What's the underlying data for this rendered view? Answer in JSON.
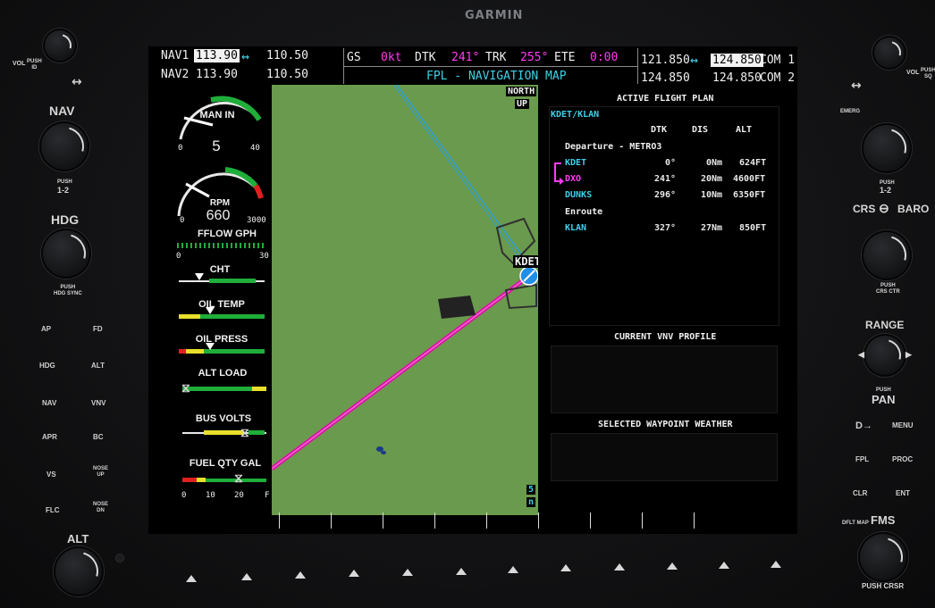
{
  "brand": "GARMIN",
  "left_panel": {
    "vol_label": "VOL",
    "vol_push": "PUSH\nID",
    "nav_label": "NAV",
    "nav_push": "PUSH",
    "nav_push2": "1-2",
    "hdg_label": "HDG",
    "hdg_push": "PUSH\nHDG SYNC",
    "buttons": [
      {
        "label": "AP"
      },
      {
        "label": "FD"
      },
      {
        "label": "HDG"
      },
      {
        "label": "ALT"
      },
      {
        "label": "NAV"
      },
      {
        "label": "VNV"
      },
      {
        "label": "APR"
      },
      {
        "label": "BC"
      },
      {
        "label": "VS"
      },
      {
        "label": "NOSE\nUP"
      },
      {
        "label": "FLC"
      },
      {
        "label": "NOSE\nDN"
      }
    ],
    "alt_label": "ALT"
  },
  "right_panel": {
    "vol_label": "VOL",
    "vol_push": "PUSH\nSQ",
    "emerg": "EMERG",
    "com_push": "PUSH",
    "com_push2": "1-2",
    "crs_baro": "CRS",
    "baro": "BARO",
    "crs_push": "PUSH\nCRS CTR",
    "range": "RANGE",
    "pan_push": "PUSH",
    "pan": "PAN",
    "buttons": [
      {
        "label": "MENU"
      },
      {
        "label": "FPL"
      },
      {
        "label": "PROC"
      },
      {
        "label": "CLR"
      },
      {
        "label": "ENT"
      }
    ],
    "direct_to": "D→",
    "dflt_map": "DFLT MAP",
    "fms": "FMS",
    "push_crsr": "PUSH CRSR"
  },
  "top_bar": {
    "nav1_label": "NAV1",
    "nav1_active": "113.90",
    "nav1_standby": "110.50",
    "nav2_label": "NAV2",
    "nav2_active": "113.90",
    "nav2_standby": "110.50",
    "gs_label": "GS",
    "gs_value": "0kt",
    "dtk_label": "DTK",
    "dtk_value": "241°",
    "trk_label": "TRK",
    "trk_value": "255°",
    "ete_label": "ETE",
    "ete_value": "0:00",
    "page_title": "FPL - NAVIGATION MAP",
    "com1_standby": "121.850",
    "com1_active": "124.850",
    "com1_label": "COM 1",
    "com2_standby": "124.850",
    "com2_active": "124.850",
    "com2_label": "COM 2"
  },
  "eis": {
    "manin_label": "MAN IN",
    "manin_value": "5",
    "manin_min": "0",
    "manin_max": "40",
    "rpm_label": "RPM",
    "rpm_value": "660",
    "rpm_min": "0",
    "rpm_max": "3000",
    "fflow_label": "FFLOW GPH",
    "fflow_min": "0",
    "fflow_max": "30",
    "cht_label": "CHT",
    "oiltemp_label": "OIL TEMP",
    "oilpress_label": "OIL PRESS",
    "altload_label": "ALT LOAD",
    "busvolts_label": "BUS VOLTS",
    "fuel_label": "FUEL QTY GAL",
    "fuel_ticks": [
      "0",
      "10",
      "20",
      "F"
    ]
  },
  "map": {
    "orientation_1": "NORTH",
    "orientation_2": "UP",
    "waypoint": "KDET",
    "range_value": "5",
    "range_unit": "n"
  },
  "flight_plan": {
    "title": "ACTIVE FLIGHT PLAN",
    "route": "KDET/KLAN",
    "columns": [
      "DTK",
      "DIS",
      "ALT"
    ],
    "departure_header": "Departure - METRO3",
    "rows": [
      {
        "wpt": "KDET",
        "dtk": "0°",
        "dis": "0Nm",
        "alt": "624FT"
      },
      {
        "wpt": "DXO",
        "dtk": "241°",
        "dis": "20Nm",
        "alt": "4600FT"
      },
      {
        "wpt": "DUNKS",
        "dtk": "296°",
        "dis": "10Nm",
        "alt": "6350FT"
      }
    ],
    "enroute_header": "Enroute",
    "enroute_rows": [
      {
        "wpt": "KLAN",
        "dtk": "327°",
        "dis": "27Nm",
        "alt": "850FT"
      }
    ],
    "vnv_title": "CURRENT VNV PROFILE",
    "weather_title": "SELECTED WAYPOINT WEATHER"
  },
  "colors": {
    "cyan": "#3fd0e8",
    "magenta": "#ff3cf0",
    "map_green": "#6a9a4d",
    "gauge_green": "#1fae3a",
    "gauge_yellow": "#e8e02a",
    "gauge_red": "#e02020"
  }
}
